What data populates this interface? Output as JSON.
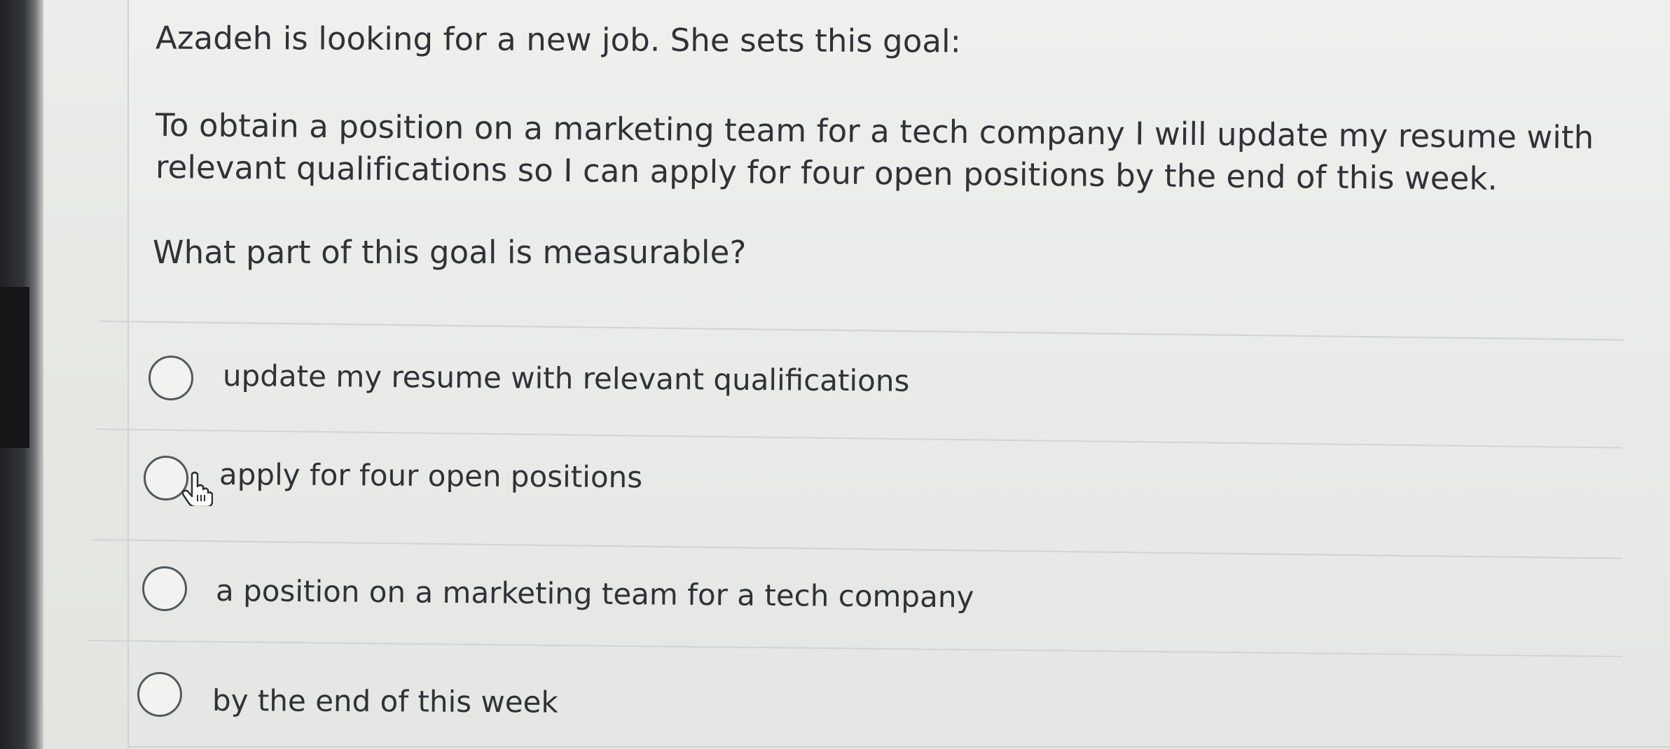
{
  "question": {
    "line1": "Azadeh is looking for a new job. She sets this goal:",
    "goal_line1": "To obtain a position on a marketing team for a tech company I will update my resume with",
    "goal_line2": "relevant qualifications so I can apply for four open positions by the end of this week.",
    "prompt": "What part of this goal is measurable?"
  },
  "options": [
    {
      "label": "update my resume with relevant qualifications",
      "selected": false
    },
    {
      "label": "apply for four open positions",
      "selected": false
    },
    {
      "label": "a position on a marketing team for a tech company",
      "selected": false
    },
    {
      "label": "by the end of this week",
      "selected": false
    }
  ],
  "icons": {
    "radio": "radio-circle",
    "cursor": "hand-pointer-icon"
  },
  "colors": {
    "text": "#2f3338",
    "radio_border": "#55595d",
    "divider": "#d2d4d1"
  }
}
